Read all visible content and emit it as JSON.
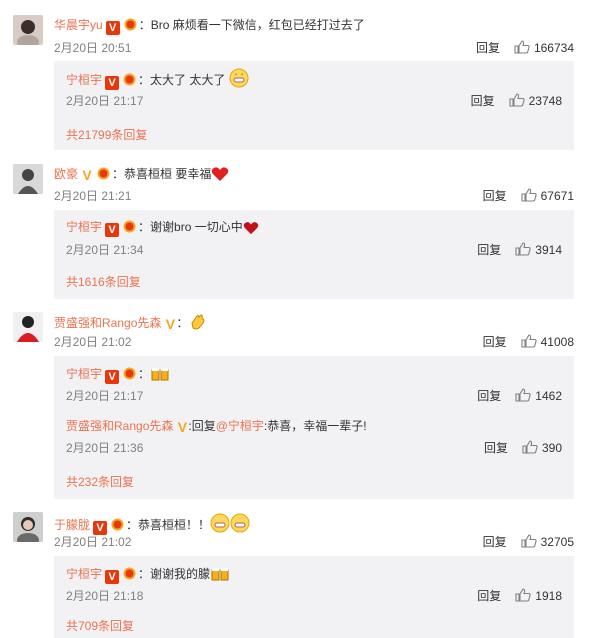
{
  "reply_label": "回复",
  "comments": [
    {
      "user": "华晨宇yu",
      "text": "Bro 麻烦看一下微信，红包已经打过去了",
      "date": "2月20日 20:51",
      "likes": "166734",
      "replies": [
        {
          "user": "宁桓宇",
          "text": "太大了 太大了",
          "date": "2月20日 21:17",
          "likes": "23748"
        }
      ],
      "more": "共21799条回复"
    },
    {
      "user": "欧豪",
      "text": "恭喜桓桓  要幸福",
      "date": "2月20日 21:21",
      "likes": "67671",
      "replies": [
        {
          "user": "宁桓宇",
          "text": "谢谢bro 一切心中",
          "date": "2月20日 21:34",
          "likes": "3914"
        }
      ],
      "more": "共1616条回复"
    },
    {
      "user": "贾盛强和Rango先森",
      "text": "",
      "date": "2月20日 21:02",
      "likes": "41008",
      "replies": [
        {
          "user": "宁桓宇",
          "text": "",
          "date": "2月20日 21:17",
          "likes": "1462"
        },
        {
          "user": "贾盛强和Rango先森",
          "reply_prefix": "回复",
          "mention": "@宁桓宇",
          "text": ":恭喜，幸福一辈子!",
          "date": "2月20日 21:36",
          "likes": "390"
        }
      ],
      "more": "共232条回复"
    },
    {
      "user": "于朦胧",
      "text": "恭喜桓桓！！",
      "date": "2月20日 21:02",
      "likes": "32705",
      "replies": [
        {
          "user": "宁桓宇",
          "text": "谢谢我的朦",
          "date": "2月20日 21:18",
          "likes": "1918"
        }
      ],
      "more": "共709条回复"
    }
  ]
}
